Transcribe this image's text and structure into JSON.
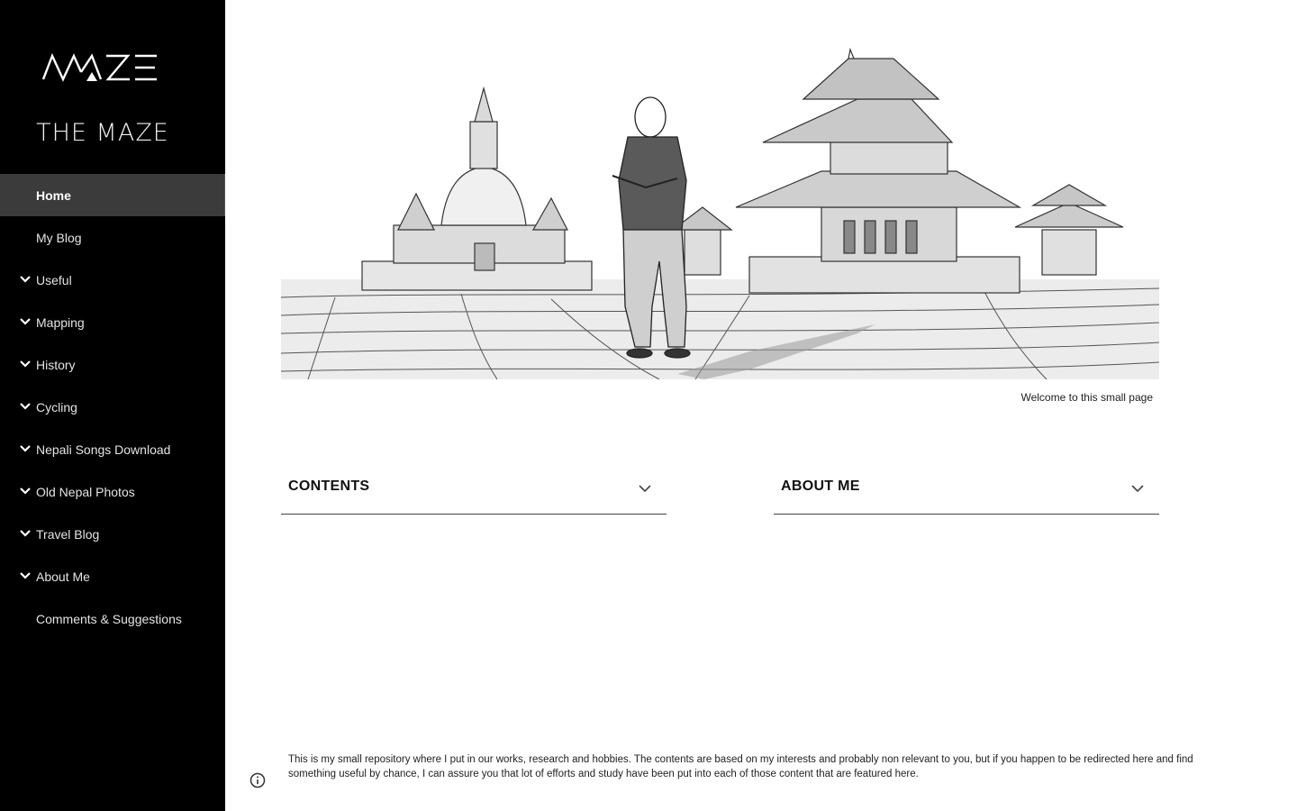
{
  "site": {
    "logo_text": "MAZE",
    "title": "THE MAZE"
  },
  "sidebar": {
    "items": [
      {
        "label": "Home",
        "active": true,
        "expandable": false
      },
      {
        "label": "My Blog",
        "active": false,
        "expandable": false
      },
      {
        "label": "Useful",
        "active": false,
        "expandable": true
      },
      {
        "label": "Mapping",
        "active": false,
        "expandable": true
      },
      {
        "label": "History",
        "active": false,
        "expandable": true
      },
      {
        "label": "Cycling",
        "active": false,
        "expandable": true
      },
      {
        "label": "Nepali Songs Download",
        "active": false,
        "expandable": true
      },
      {
        "label": "Old Nepal Photos",
        "active": false,
        "expandable": true
      },
      {
        "label": "Travel Blog",
        "active": false,
        "expandable": true
      },
      {
        "label": "About Me",
        "active": false,
        "expandable": true
      },
      {
        "label": "Comments & Suggestions",
        "active": false,
        "expandable": false
      }
    ]
  },
  "main": {
    "hero_caption": "Welcome to this small page",
    "sections": [
      {
        "label": "CONTENTS"
      },
      {
        "label": "ABOUT ME"
      }
    ],
    "footer": "This is my small repository where I put in our works, research and hobbies. The contents are based on my interests and probably non relevant to you, but if you happen to be redirected here and find something useful by chance, I can assure you that lot of efforts and study have been put into each of those content that are featured here."
  },
  "icons": {
    "nav_chevron": "chevron-down-icon",
    "section_chevron": "chevron-down-icon",
    "info": "info-icon"
  },
  "colors": {
    "sidebar_bg": "#000000",
    "active_item_bg": "#3b3b3b",
    "text_light": "#e4e4e4",
    "text_dark": "#111111"
  }
}
